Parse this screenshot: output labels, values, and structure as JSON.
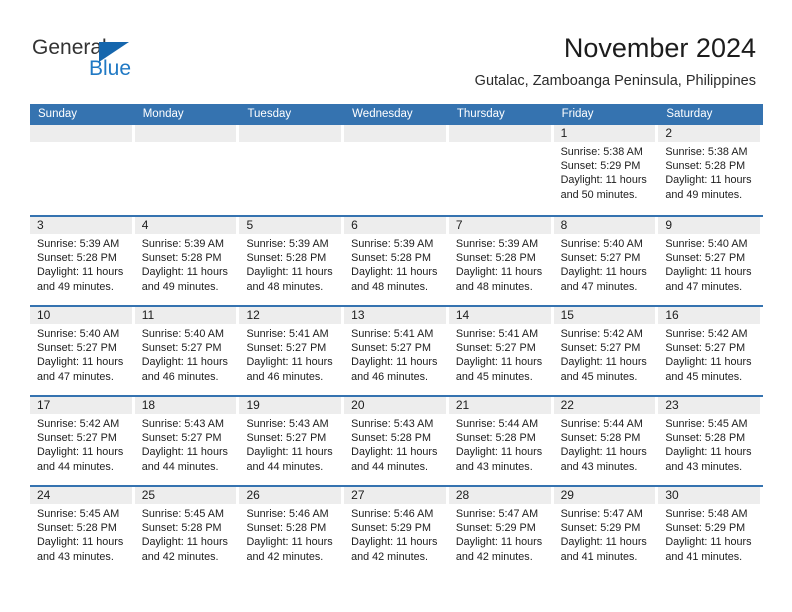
{
  "brand": {
    "word_one": "General",
    "word_two": "Blue",
    "triangle_icon": "triangle-icon",
    "accent_color": "#2079c4"
  },
  "header": {
    "title": "November 2024",
    "subtitle": "Gutalac, Zamboanga Peninsula, Philippines"
  },
  "theme": {
    "header_blue": "#3573b0",
    "daynum_gray": "#ededed",
    "text": "#1d1d1d"
  },
  "weekdays": [
    "Sunday",
    "Monday",
    "Tuesday",
    "Wednesday",
    "Thursday",
    "Friday",
    "Saturday"
  ],
  "labels": {
    "sunrise_prefix": "Sunrise:",
    "sunset_prefix": "Sunset:",
    "daylight_prefix": "Daylight:"
  },
  "weeks": [
    [
      {
        "day": "",
        "empty": true,
        "sunrise": "",
        "sunset": "",
        "daylight": ""
      },
      {
        "day": "",
        "empty": true,
        "sunrise": "",
        "sunset": "",
        "daylight": ""
      },
      {
        "day": "",
        "empty": true,
        "sunrise": "",
        "sunset": "",
        "daylight": ""
      },
      {
        "day": "",
        "empty": true,
        "sunrise": "",
        "sunset": "",
        "daylight": ""
      },
      {
        "day": "",
        "empty": true,
        "sunrise": "",
        "sunset": "",
        "daylight": ""
      },
      {
        "day": "1",
        "empty": false,
        "sunrise": "Sunrise: 5:38 AM",
        "sunset": "Sunset: 5:29 PM",
        "daylight": "Daylight: 11 hours and 50 minutes."
      },
      {
        "day": "2",
        "empty": false,
        "sunrise": "Sunrise: 5:38 AM",
        "sunset": "Sunset: 5:28 PM",
        "daylight": "Daylight: 11 hours and 49 minutes."
      }
    ],
    [
      {
        "day": "3",
        "empty": false,
        "sunrise": "Sunrise: 5:39 AM",
        "sunset": "Sunset: 5:28 PM",
        "daylight": "Daylight: 11 hours and 49 minutes."
      },
      {
        "day": "4",
        "empty": false,
        "sunrise": "Sunrise: 5:39 AM",
        "sunset": "Sunset: 5:28 PM",
        "daylight": "Daylight: 11 hours and 49 minutes."
      },
      {
        "day": "5",
        "empty": false,
        "sunrise": "Sunrise: 5:39 AM",
        "sunset": "Sunset: 5:28 PM",
        "daylight": "Daylight: 11 hours and 48 minutes."
      },
      {
        "day": "6",
        "empty": false,
        "sunrise": "Sunrise: 5:39 AM",
        "sunset": "Sunset: 5:28 PM",
        "daylight": "Daylight: 11 hours and 48 minutes."
      },
      {
        "day": "7",
        "empty": false,
        "sunrise": "Sunrise: 5:39 AM",
        "sunset": "Sunset: 5:28 PM",
        "daylight": "Daylight: 11 hours and 48 minutes."
      },
      {
        "day": "8",
        "empty": false,
        "sunrise": "Sunrise: 5:40 AM",
        "sunset": "Sunset: 5:27 PM",
        "daylight": "Daylight: 11 hours and 47 minutes."
      },
      {
        "day": "9",
        "empty": false,
        "sunrise": "Sunrise: 5:40 AM",
        "sunset": "Sunset: 5:27 PM",
        "daylight": "Daylight: 11 hours and 47 minutes."
      }
    ],
    [
      {
        "day": "10",
        "empty": false,
        "sunrise": "Sunrise: 5:40 AM",
        "sunset": "Sunset: 5:27 PM",
        "daylight": "Daylight: 11 hours and 47 minutes."
      },
      {
        "day": "11",
        "empty": false,
        "sunrise": "Sunrise: 5:40 AM",
        "sunset": "Sunset: 5:27 PM",
        "daylight": "Daylight: 11 hours and 46 minutes."
      },
      {
        "day": "12",
        "empty": false,
        "sunrise": "Sunrise: 5:41 AM",
        "sunset": "Sunset: 5:27 PM",
        "daylight": "Daylight: 11 hours and 46 minutes."
      },
      {
        "day": "13",
        "empty": false,
        "sunrise": "Sunrise: 5:41 AM",
        "sunset": "Sunset: 5:27 PM",
        "daylight": "Daylight: 11 hours and 46 minutes."
      },
      {
        "day": "14",
        "empty": false,
        "sunrise": "Sunrise: 5:41 AM",
        "sunset": "Sunset: 5:27 PM",
        "daylight": "Daylight: 11 hours and 45 minutes."
      },
      {
        "day": "15",
        "empty": false,
        "sunrise": "Sunrise: 5:42 AM",
        "sunset": "Sunset: 5:27 PM",
        "daylight": "Daylight: 11 hours and 45 minutes."
      },
      {
        "day": "16",
        "empty": false,
        "sunrise": "Sunrise: 5:42 AM",
        "sunset": "Sunset: 5:27 PM",
        "daylight": "Daylight: 11 hours and 45 minutes."
      }
    ],
    [
      {
        "day": "17",
        "empty": false,
        "sunrise": "Sunrise: 5:42 AM",
        "sunset": "Sunset: 5:27 PM",
        "daylight": "Daylight: 11 hours and 44 minutes."
      },
      {
        "day": "18",
        "empty": false,
        "sunrise": "Sunrise: 5:43 AM",
        "sunset": "Sunset: 5:27 PM",
        "daylight": "Daylight: 11 hours and 44 minutes."
      },
      {
        "day": "19",
        "empty": false,
        "sunrise": "Sunrise: 5:43 AM",
        "sunset": "Sunset: 5:27 PM",
        "daylight": "Daylight: 11 hours and 44 minutes."
      },
      {
        "day": "20",
        "empty": false,
        "sunrise": "Sunrise: 5:43 AM",
        "sunset": "Sunset: 5:28 PM",
        "daylight": "Daylight: 11 hours and 44 minutes."
      },
      {
        "day": "21",
        "empty": false,
        "sunrise": "Sunrise: 5:44 AM",
        "sunset": "Sunset: 5:28 PM",
        "daylight": "Daylight: 11 hours and 43 minutes."
      },
      {
        "day": "22",
        "empty": false,
        "sunrise": "Sunrise: 5:44 AM",
        "sunset": "Sunset: 5:28 PM",
        "daylight": "Daylight: 11 hours and 43 minutes."
      },
      {
        "day": "23",
        "empty": false,
        "sunrise": "Sunrise: 5:45 AM",
        "sunset": "Sunset: 5:28 PM",
        "daylight": "Daylight: 11 hours and 43 minutes."
      }
    ],
    [
      {
        "day": "24",
        "empty": false,
        "sunrise": "Sunrise: 5:45 AM",
        "sunset": "Sunset: 5:28 PM",
        "daylight": "Daylight: 11 hours and 43 minutes."
      },
      {
        "day": "25",
        "empty": false,
        "sunrise": "Sunrise: 5:45 AM",
        "sunset": "Sunset: 5:28 PM",
        "daylight": "Daylight: 11 hours and 42 minutes."
      },
      {
        "day": "26",
        "empty": false,
        "sunrise": "Sunrise: 5:46 AM",
        "sunset": "Sunset: 5:28 PM",
        "daylight": "Daylight: 11 hours and 42 minutes."
      },
      {
        "day": "27",
        "empty": false,
        "sunrise": "Sunrise: 5:46 AM",
        "sunset": "Sunset: 5:29 PM",
        "daylight": "Daylight: 11 hours and 42 minutes."
      },
      {
        "day": "28",
        "empty": false,
        "sunrise": "Sunrise: 5:47 AM",
        "sunset": "Sunset: 5:29 PM",
        "daylight": "Daylight: 11 hours and 42 minutes."
      },
      {
        "day": "29",
        "empty": false,
        "sunrise": "Sunrise: 5:47 AM",
        "sunset": "Sunset: 5:29 PM",
        "daylight": "Daylight: 11 hours and 41 minutes."
      },
      {
        "day": "30",
        "empty": false,
        "sunrise": "Sunrise: 5:48 AM",
        "sunset": "Sunset: 5:29 PM",
        "daylight": "Daylight: 11 hours and 41 minutes."
      }
    ]
  ]
}
